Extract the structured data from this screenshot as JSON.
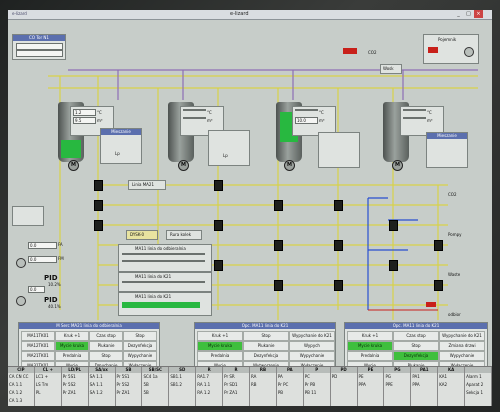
{
  "window": {
    "title": "e-lizard",
    "tab_left": "e-lizard",
    "minimize": "_",
    "maximize": "□",
    "close": "×"
  },
  "colors": {
    "active": "#3fbf3d",
    "alarm": "#c8201a",
    "header": "#5b6fae",
    "pipe": "#d8d24a",
    "pipe2": "#8e6fb6"
  },
  "top_left_box": {
    "title": "CO Tor N1",
    "rows": [
      "",
      ""
    ]
  },
  "pojemnik": {
    "label": "Pojemnik",
    "caption": "Wosk"
  },
  "tanks": [
    {
      "id": "T1",
      "v1": "1.2",
      "v2": "9.5",
      "u1": "°C",
      "u2": "m³",
      "extra": [
        "Mieszanie",
        "",
        "Lp"
      ]
    },
    {
      "id": "T2",
      "v1": "",
      "v2": "",
      "u1": "°C",
      "u2": "m³",
      "extra": [
        "",
        "",
        "Lp"
      ]
    },
    {
      "id": "T3",
      "v1": "",
      "v2": "10.0",
      "u1": "°C",
      "u2": "m³",
      "extra": [
        "",
        "",
        ""
      ]
    },
    {
      "id": "T4",
      "v1": "",
      "v2": "",
      "u1": "°C",
      "u2": "m³",
      "extra": [
        "Mieszanie",
        "",
        ""
      ]
    }
  ],
  "mid_labels": {
    "linia": "Linia MA21",
    "dyski": "DYSK-0",
    "krawedz": "Rura kolek",
    "ma11a": "MA11 linia do odbieralnia",
    "ma11b": "MA11 linia do K21",
    "ma11c": "MA11 linia do K21"
  },
  "left_controls": {
    "fa_label": "FA",
    "fm_label": "FM",
    "pid1": "PID",
    "pid2": "PID",
    "pid_val1": "10.2%",
    "pid_val2": "40.1%",
    "in1": "0.0",
    "in2": "0.0",
    "in3": "0.0"
  },
  "right_labels": {
    "r1": "CO2",
    "r2": "Pompy",
    "r3": "Waste",
    "r4": "odbior"
  },
  "panels": [
    {
      "title": "M Serc MA21 linia do odbieralnia",
      "rows": [
        [
          "MA11TK01",
          "Kruk +1",
          "Czas stop",
          "Stop"
        ],
        [
          "MA12TK01",
          "Mycie kruka",
          "Plukanie",
          "Dezynfekcja"
        ],
        [
          "MA21TK01",
          "Predalnia",
          "Stop",
          "Wypychanie"
        ],
        [
          "MA31TK01",
          "Mycie",
          "Dmuchanie",
          "Wyłączenie"
        ]
      ]
    },
    {
      "title": "Opc. MA11 linia do K21",
      "rows": [
        [
          "Kruk +1",
          "Stop",
          "Wypychanie do K21"
        ],
        [
          "Mycie kruka",
          "Plukanie",
          "Wypych"
        ],
        [
          "Predalnia",
          "Dezynfekcja",
          "Wypychanie calkowite"
        ],
        [
          "Mycie",
          "Wytworzenie",
          "Wyłączenie"
        ]
      ]
    },
    {
      "title": "Opc. MA11 linia do K21",
      "rows": [
        [
          "Kruk +1",
          "Czas stop",
          "Wypychanie do K21"
        ],
        [
          "Mycie kruka",
          "Stop",
          "Zmiana drzwi"
        ],
        [
          "Predalnia",
          "Dezynfekcja",
          "Wypychanie calkowite"
        ],
        [
          "Mycie",
          "Plukanie",
          "Wyłączenie"
        ]
      ]
    }
  ],
  "bottom": {
    "cols": [
      {
        "h": "CIP",
        "r": [
          "CA CN CC",
          "CA 1.1",
          "CA 1.2",
          "CA 1.3"
        ]
      },
      {
        "h": "CL +",
        "r": [
          "LC1 +",
          "LS Tm",
          "PL",
          ""
        ]
      },
      {
        "h": "LD/PL",
        "r": [
          "Pr 5S1",
          "Pr 5S2",
          "Pr ZA1",
          ""
        ]
      },
      {
        "h": "SA/xx",
        "r": [
          "SA 1.1",
          "SA 1.1",
          "SA 1.2",
          ""
        ]
      },
      {
        "h": "SB",
        "r": [
          "Pr 5S1",
          "Pr 5S2",
          "Pr ZA1",
          ""
        ]
      },
      {
        "h": "SB/SC",
        "r": [
          "SC4 1a",
          "5B",
          "5B",
          ""
        ]
      },
      {
        "h": "SD",
        "r": [
          "SB1.1",
          "SB1.2",
          "",
          ""
        ]
      },
      {
        "h": "R",
        "r": [
          "RA1.7",
          "RA 1.1",
          "RA 1.2",
          ""
        ]
      },
      {
        "h": "R",
        "r": [
          "Pr SR",
          "Pr SD1",
          "Pr ZA1",
          ""
        ]
      },
      {
        "h": "RB",
        "r": [
          "RA",
          "RB",
          "",
          ""
        ]
      },
      {
        "h": "PA",
        "r": [
          "PA",
          "Pr PC",
          "PB",
          ""
        ]
      },
      {
        "h": "P",
        "r": [
          "PC",
          "Pr PB",
          "PB 11",
          ""
        ]
      },
      {
        "h": "PD",
        "r": [
          "PD",
          "",
          "",
          ""
        ]
      },
      {
        "h": "PE",
        "r": [
          "PE",
          "PPA",
          "",
          ""
        ]
      },
      {
        "h": "PG",
        "r": [
          "PG",
          "PPE",
          "",
          ""
        ]
      },
      {
        "h": "PA1",
        "r": [
          "PA1",
          "PPA",
          "",
          ""
        ]
      },
      {
        "h": "KA",
        "r": [
          "KA1",
          "KA2",
          "",
          ""
        ]
      },
      {
        "h": "",
        "r": [
          "Alarm 1",
          "Aparat 2",
          "Sekcja 1",
          ""
        ]
      }
    ]
  }
}
